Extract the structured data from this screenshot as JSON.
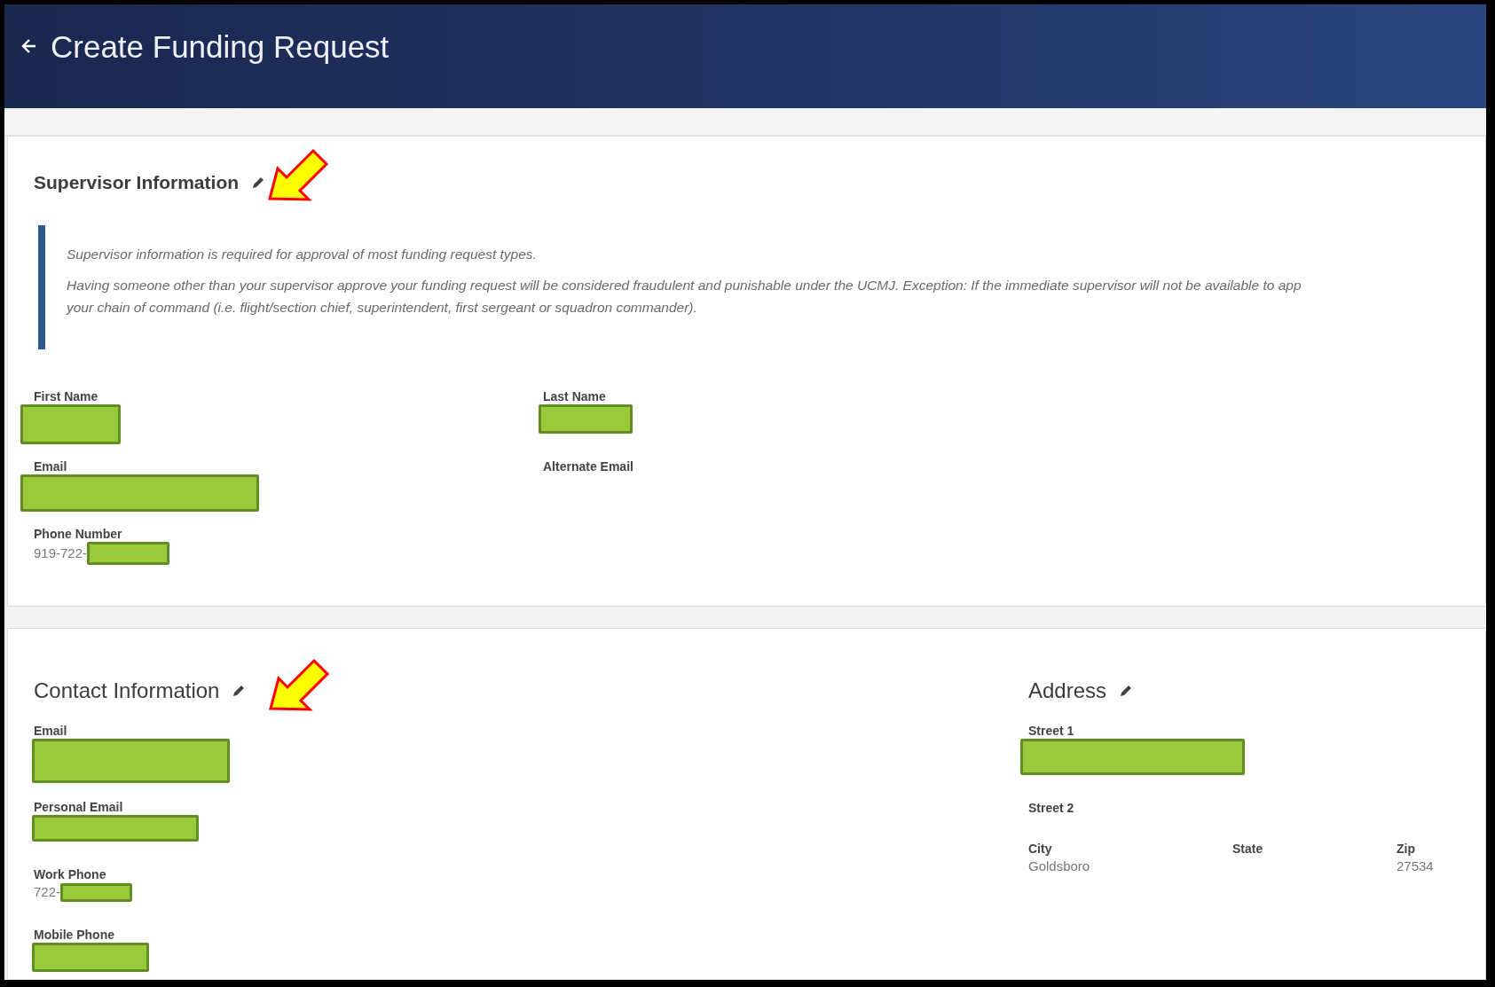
{
  "header": {
    "title": "Create Funding Request"
  },
  "supervisor": {
    "title": "Supervisor Information",
    "highlighted": true,
    "notes": [
      {
        "lines": [
          "Supervisor information is required for approval of most funding request types."
        ]
      },
      {
        "lines": [
          "Having someone other than your supervisor approve your funding request will be considered fraudulent and punishable under the UCMJ. Exception: If the immediate supervisor will not be available to app",
          "your chain of command (i.e. flight/section chief, superintendent, first sergeant or squadron commander)."
        ]
      }
    ],
    "fields": [
      {
        "label": "First Name",
        "redacted": true
      },
      {
        "label": "Last Name",
        "redacted": true
      },
      {
        "label": "Email",
        "redacted": true
      },
      {
        "label": "Alternate Email",
        "redacted": false
      },
      {
        "label": "Phone Number",
        "value": "919-722-",
        "redacted": true
      }
    ]
  },
  "contact": {
    "title": "Contact Information",
    "highlighted": true,
    "fields": [
      {
        "label": "Email",
        "redacted": true
      },
      {
        "label": "Personal Email",
        "redacted": true
      },
      {
        "label": "Work Phone",
        "value": "722-",
        "redacted": true
      },
      {
        "label": "Mobile Phone",
        "redacted": true
      }
    ]
  },
  "address": {
    "title": "Address",
    "highlighted": false,
    "fields": [
      {
        "label": "Street 1",
        "kind": "wide",
        "redacted": true
      },
      {
        "label": "Street 2",
        "kind": "wide",
        "redacted": false
      },
      {
        "label": "City",
        "kind": "column",
        "value": "Goldsboro",
        "redacted": false
      },
      {
        "label": "State",
        "kind": "column",
        "redacted": false
      },
      {
        "label": "Zip",
        "kind": "column",
        "value": "27534",
        "redacted": false
      }
    ]
  }
}
